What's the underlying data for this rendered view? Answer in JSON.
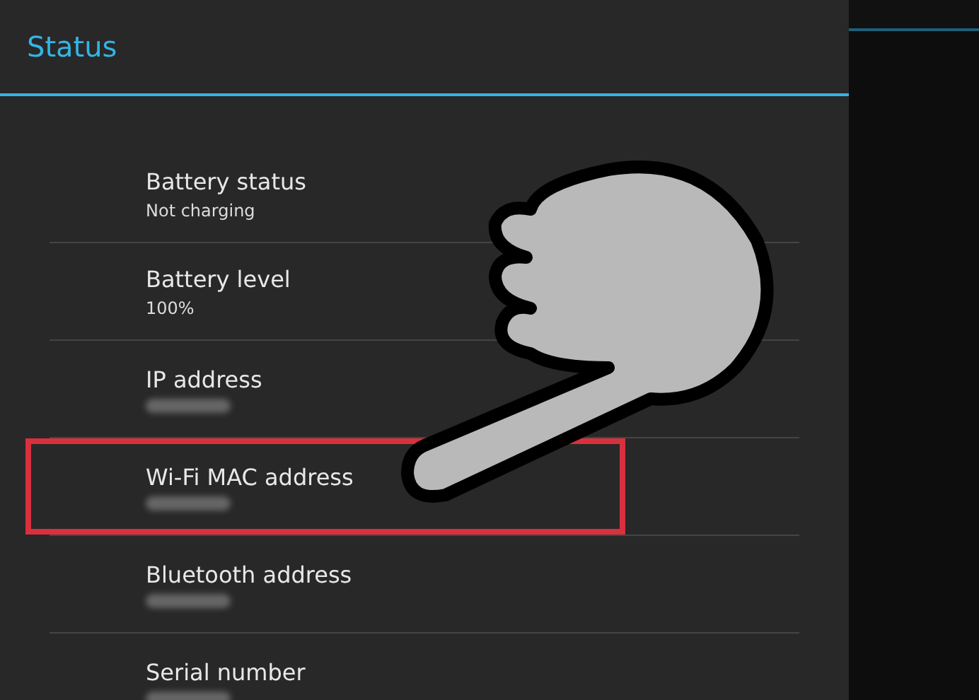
{
  "header": {
    "title": "Status"
  },
  "items": [
    {
      "title": "Battery status",
      "kind": "text",
      "summary": "Not charging",
      "highlighted": false
    },
    {
      "title": "Battery level",
      "kind": "text",
      "summary": "100%",
      "highlighted": false
    },
    {
      "title": "IP address",
      "kind": "blurred",
      "highlighted": false
    },
    {
      "title": "Wi-Fi MAC address",
      "kind": "blurred",
      "highlighted": true
    },
    {
      "title": "Bluetooth address",
      "kind": "blurred",
      "highlighted": false
    },
    {
      "title": "Serial number",
      "kind": "blurred",
      "highlighted": false
    }
  ]
}
